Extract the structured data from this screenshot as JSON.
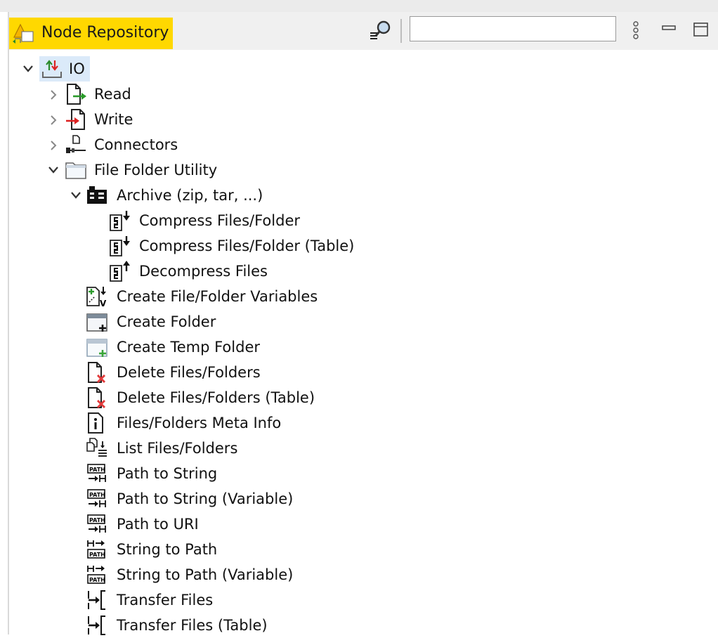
{
  "panel": {
    "title": "Node Repository",
    "search_placeholder": "",
    "icons": {
      "panel": "node-repository-icon",
      "search_toggle": "search-icon",
      "menu": "view-menu-icon",
      "minimize": "minimize-icon",
      "maximize": "maximize-icon"
    }
  },
  "tree": {
    "root": {
      "label": "IO",
      "expanded": true
    },
    "items": [
      {
        "label": "Read",
        "expanded": false
      },
      {
        "label": "Write",
        "expanded": false
      },
      {
        "label": "Connectors",
        "expanded": false
      },
      {
        "label": "File Folder Utility",
        "expanded": true
      },
      {
        "label": "Archive (zip, tar, ...)",
        "expanded": true
      },
      {
        "label": "Compress Files/Folder"
      },
      {
        "label": "Compress Files/Folder (Table)"
      },
      {
        "label": "Decompress Files"
      },
      {
        "label": "Create File/Folder Variables"
      },
      {
        "label": "Create Folder"
      },
      {
        "label": "Create Temp Folder"
      },
      {
        "label": "Delete Files/Folders"
      },
      {
        "label": "Delete Files/Folders (Table)"
      },
      {
        "label": "Files/Folders Meta Info"
      },
      {
        "label": "List Files/Folders"
      },
      {
        "label": "Path to String"
      },
      {
        "label": "Path to String (Variable)"
      },
      {
        "label": "Path to URI"
      },
      {
        "label": "String to Path"
      },
      {
        "label": "String to Path (Variable)"
      },
      {
        "label": "Transfer Files"
      },
      {
        "label": "Transfer Files (Table)"
      }
    ]
  }
}
